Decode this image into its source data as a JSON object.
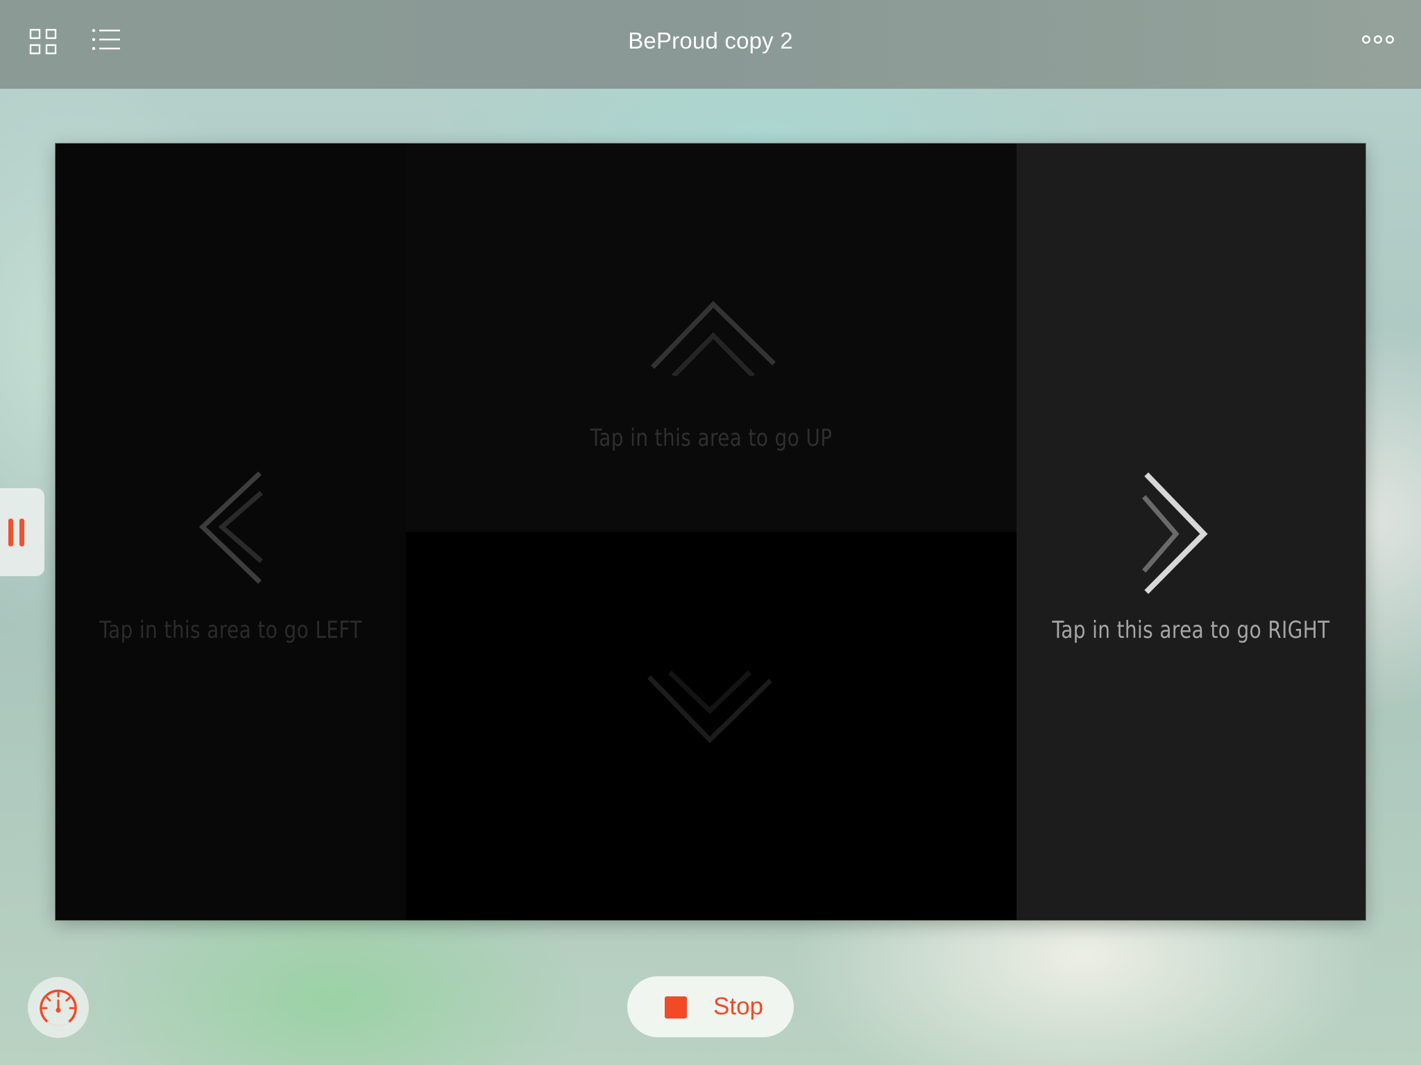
{
  "header": {
    "title": "BeProud copy 2",
    "left_icons": [
      "grid-view-icon",
      "list-view-icon"
    ],
    "right_icon": "more-options-icon"
  },
  "stage": {
    "zones": {
      "left": {
        "label": "Tap in this area to go LEFT",
        "direction": "left",
        "highlighted": false
      },
      "up": {
        "label": "Tap in this area to go UP",
        "direction": "up",
        "highlighted": false
      },
      "down": {
        "label": "",
        "direction": "down",
        "highlighted": false
      },
      "right": {
        "label": "Tap in this area to go RIGHT",
        "direction": "right",
        "highlighted": true
      }
    }
  },
  "controls": {
    "pause_icon": "pause-icon",
    "speed_icon": "speedometer-icon",
    "stop_label": "Stop",
    "stop_icon": "stop-square-icon"
  },
  "colors": {
    "accent": "#f24a26",
    "nav_bar": "#8b9a95",
    "stage_background": "#000000",
    "zone_highlight": "#1c1c1c"
  }
}
